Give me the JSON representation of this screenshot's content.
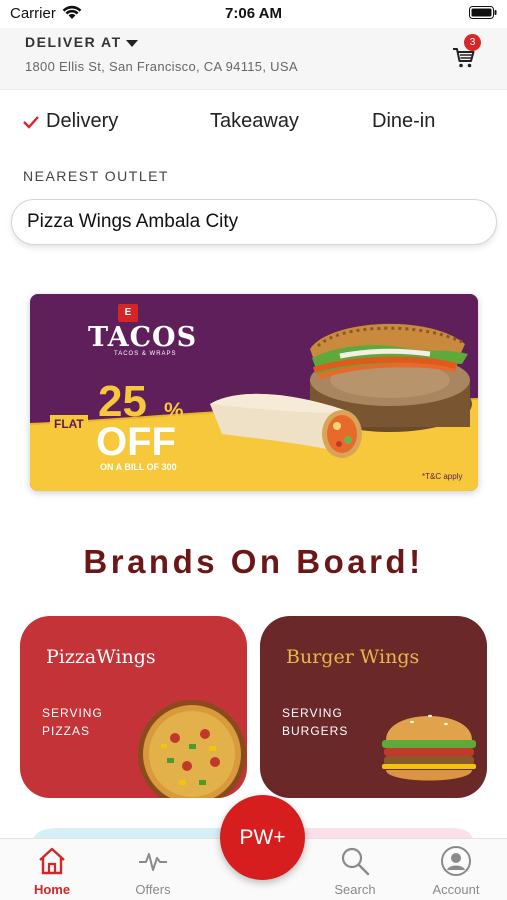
{
  "status_bar": {
    "carrier": "Carrier",
    "time": "7:06 AM"
  },
  "header": {
    "deliver_label": "DELIVER AT",
    "address": "1800 Ellis St, San Francisco, CA 94115, USA",
    "cart_count": "3"
  },
  "order_types": {
    "delivery": "Delivery",
    "takeaway": "Takeaway",
    "dine_in": "Dine-in",
    "selected": "Delivery"
  },
  "outlet": {
    "label": "NEAREST OUTLET",
    "value": "Pizza Wings Ambala City"
  },
  "banner": {
    "brand": "TACOS",
    "brand_sub": "TACOS & WRAPS",
    "brand_badge": "E",
    "flat": "FLAT",
    "percent": "25",
    "percent_sign": "%",
    "off": "OFF",
    "bill_text": "ON A BILL OF 300",
    "terms": "*T&C apply"
  },
  "brands_section": {
    "title": "Brands On Board!",
    "cards": [
      {
        "name": "PizzaWings",
        "serving_1": "SERVING",
        "serving_2": "PIZZAS"
      },
      {
        "name": "Burger Wings",
        "serving_1": "SERVING",
        "serving_2": "BURGERS"
      }
    ]
  },
  "bottom_nav": {
    "home": "Home",
    "offers": "Offers",
    "center": "PW+",
    "search": "Search",
    "account": "Account"
  },
  "colors": {
    "accent_red": "#d42626",
    "pizza_card": "#c43337",
    "burger_card": "#6a2829",
    "title_maroon": "#6b1717",
    "banner_purple": "#5e1f5b",
    "banner_yellow": "#f7c83b"
  }
}
